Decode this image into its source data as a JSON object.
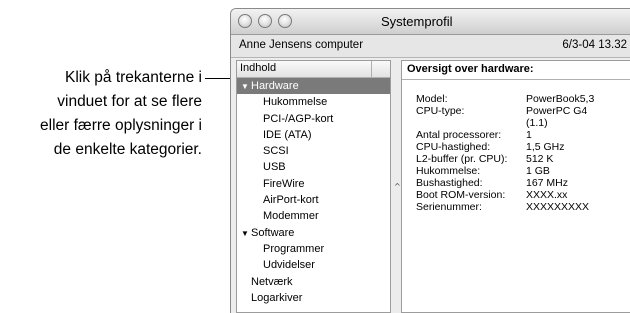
{
  "callout": {
    "lines": [
      "Klik på trekanterne i",
      "vinduet for at se flere",
      "eller færre oplysninger i",
      "de enkelte kategorier."
    ]
  },
  "window": {
    "title": "Systemprofil",
    "computer_name": "Anne Jensens computer",
    "date": "6/3-04 13.32"
  },
  "sidebar": {
    "header": "Indhold",
    "items": [
      {
        "label": "Hardware",
        "expanded": true,
        "selected": true
      },
      {
        "label": "Hukommelse"
      },
      {
        "label": "PCI-/AGP-kort"
      },
      {
        "label": "IDE (ATA)"
      },
      {
        "label": "SCSI"
      },
      {
        "label": "USB"
      },
      {
        "label": "FireWire"
      },
      {
        "label": "AirPort-kort"
      },
      {
        "label": "Modemmer"
      },
      {
        "label": "Software",
        "expanded": true
      },
      {
        "label": "Programmer"
      },
      {
        "label": "Udvidelser"
      },
      {
        "label": "Netværk"
      },
      {
        "label": "Logarkiver"
      }
    ]
  },
  "overview": {
    "title": "Oversigt over hardware:",
    "rows": [
      {
        "key": "Model:",
        "value": "PowerBook5,3"
      },
      {
        "key": "CPU-type:",
        "value": "PowerPC G4"
      },
      {
        "key": "",
        "value": "(1.1)"
      },
      {
        "key": "Antal processorer:",
        "value": "1"
      },
      {
        "key": "CPU-hastighed:",
        "value": "1,5 GHz"
      },
      {
        "key": "L2-buffer (pr. CPU):",
        "value": "512 K"
      },
      {
        "key": "Hukommelse:",
        "value": "1 GB"
      },
      {
        "key": "Bushastighed:",
        "value": "167 MHz"
      },
      {
        "key": "Boot ROM-version:",
        "value": "XXXX.xx"
      },
      {
        "key": "Serienummer:",
        "value": "XXXXXXXXX"
      }
    ]
  }
}
